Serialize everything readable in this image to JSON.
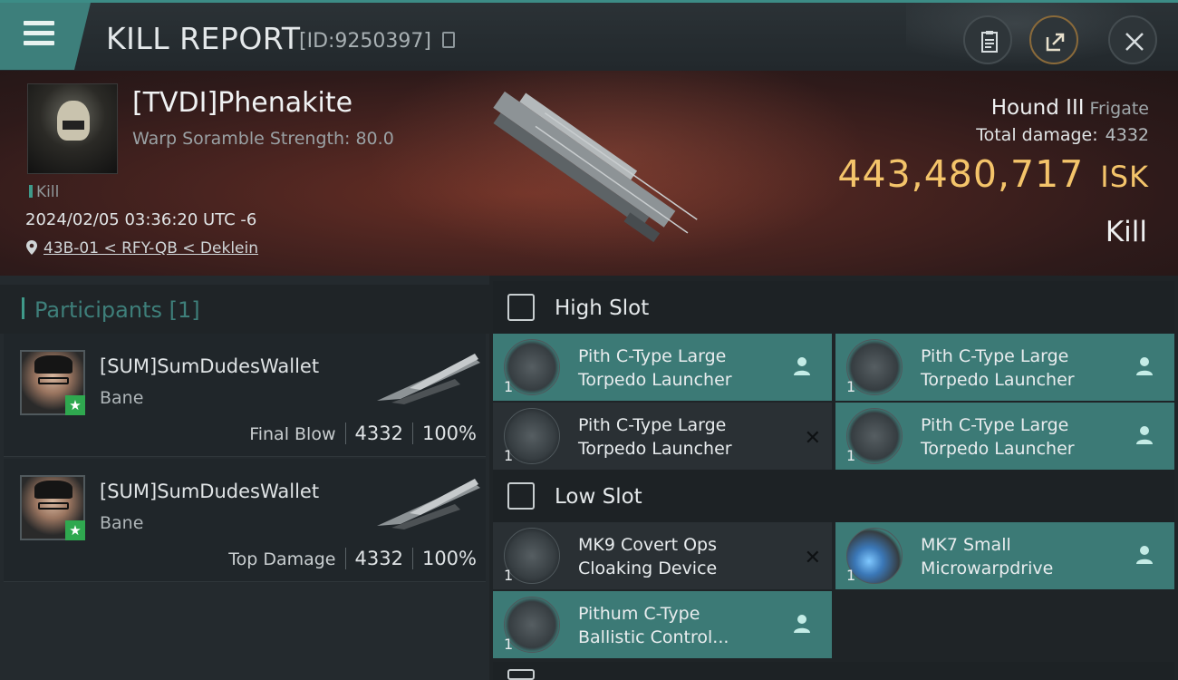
{
  "header": {
    "title": "KILL REPORT",
    "report_id": "[ID:9250397]"
  },
  "victim": {
    "name": "[TVDI]Phenakite",
    "subtitle": "Warp Soramble Strength: 80.0",
    "kill_tag": "Kill",
    "timestamp": "2024/02/05 03:36:20 UTC -6",
    "location": "43B-01 < RFY-QB < Deklein",
    "ship": "Hound III",
    "ship_class": "Frigate",
    "total_damage_label": "Total damage:",
    "total_damage": "4332",
    "isk_value": "443,480,717",
    "isk_unit": "ISK",
    "result": "Kill"
  },
  "participants": {
    "heading": "Participants",
    "count": "[1]",
    "rows": [
      {
        "name": "[SUM]SumDudesWallet",
        "ship": "Bane",
        "tag": "Final Blow",
        "damage": "4332",
        "percent": "100%"
      },
      {
        "name": "[SUM]SumDudesWallet",
        "ship": "Bane",
        "tag": "Top Damage",
        "damage": "4332",
        "percent": "100%"
      }
    ]
  },
  "slots": {
    "high_label": "High Slot",
    "low_label": "Low Slot",
    "high": [
      {
        "line1": "Pith C-Type Large",
        "line2": "Torpedo Launcher",
        "qty": "1"
      },
      {
        "line1": "Pith C-Type Large",
        "line2": "Torpedo Launcher",
        "qty": "1"
      },
      {
        "line1": "Pith C-Type Large",
        "line2": "Torpedo Launcher",
        "qty": "1"
      },
      {
        "line1": "Pith C-Type Large",
        "line2": "Torpedo Launcher",
        "qty": "1"
      }
    ],
    "low": [
      {
        "line1": "MK9 Covert Ops",
        "line2": "Cloaking Device",
        "qty": "1"
      },
      {
        "line1": "MK7 Small",
        "line2": "Microwarpdrive",
        "qty": "1"
      },
      {
        "line1": "Pithum C-Type",
        "line2": "Ballistic Control...",
        "qty": "1"
      }
    ]
  },
  "colors": {
    "accent": "#3c7a76",
    "isk": "#f4c46a",
    "header": "#22282c"
  },
  "icons": [
    "menu-icon",
    "copy-icon",
    "clipboard-icon",
    "share-icon",
    "close-icon",
    "location-pin-icon",
    "slot-icon",
    "pilot-icon",
    "destroyed-x-icon"
  ]
}
